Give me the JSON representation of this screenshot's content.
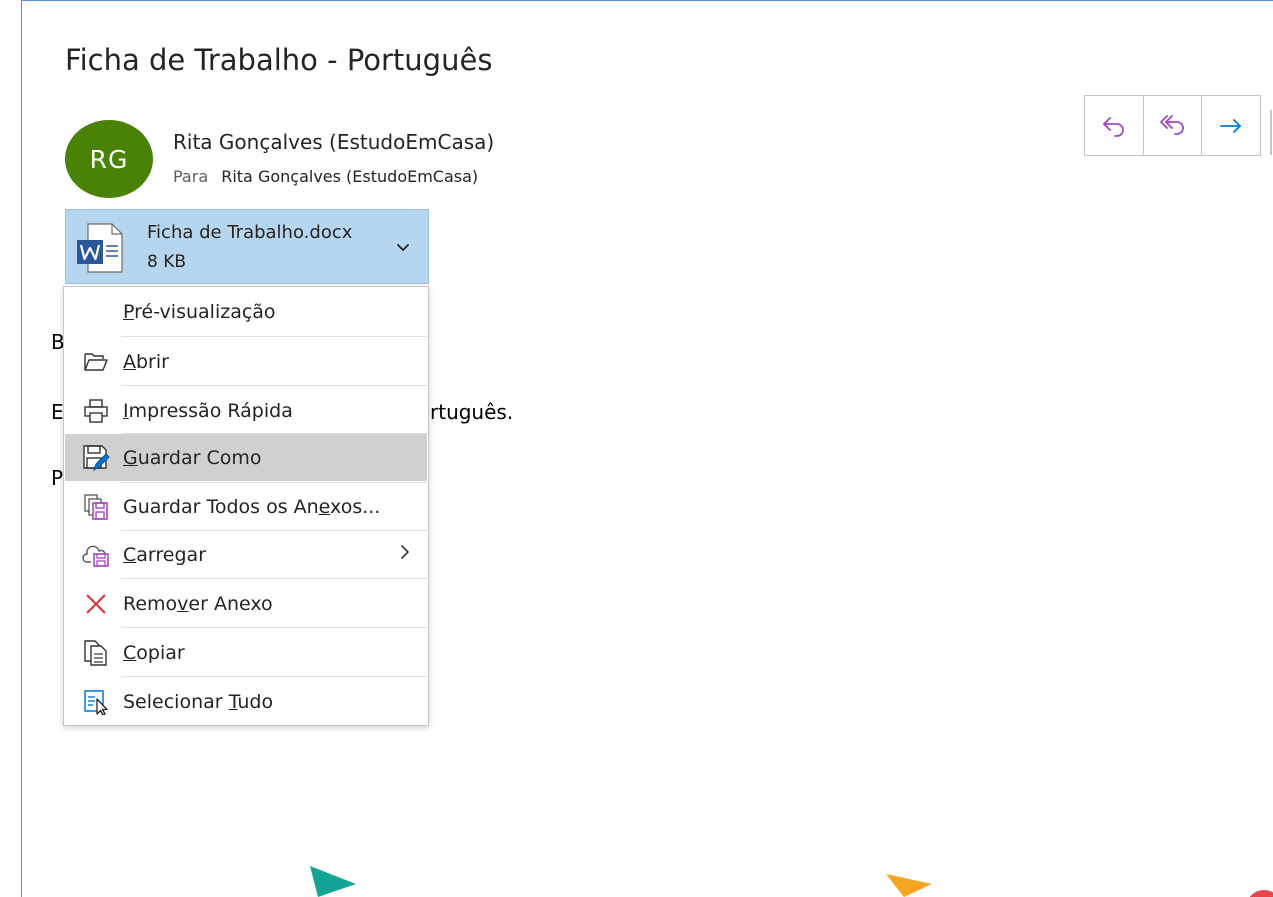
{
  "email": {
    "subject": "Ficha de Trabalho - Português",
    "avatar_initials": "RG",
    "avatar_color": "#498205",
    "sender": "Rita Gonçalves (EstudoEmCasa)",
    "to_label": "Para",
    "to_name": "Rita Gonçalves (EstudoEmCasa)"
  },
  "actions": [
    {
      "name": "reply",
      "icon": "reply-icon"
    },
    {
      "name": "reply-all",
      "icon": "reply-all-icon"
    },
    {
      "name": "forward",
      "icon": "forward-icon"
    }
  ],
  "attachment": {
    "icon": "word-document-icon",
    "name": "Ficha de Trabalho.docx",
    "size": "8 KB"
  },
  "body_lines": [
    {
      "text": "B"
    },
    {
      "text": "E",
      "suffix": "rtuguês."
    },
    {
      "text": "P"
    }
  ],
  "context_menu": {
    "items": [
      {
        "label": "Pré-visualização",
        "icon": null,
        "access_key": "P"
      },
      {
        "label": "Abrir",
        "icon": "folder-open-icon",
        "access_key": "A"
      },
      {
        "label": "Impressão Rápida",
        "icon": "printer-icon",
        "access_key": "I"
      },
      {
        "label": "Guardar Como",
        "icon": "save-as-icon",
        "access_key": "G",
        "highlighted": true
      },
      {
        "label": "Guardar Todos os Anexos...",
        "icon": "save-all-icon",
        "access_key": "e"
      },
      {
        "label": "Carregar",
        "icon": "cloud-upload-icon",
        "access_key": "C",
        "submenu": true
      },
      {
        "label": "Remover Anexo",
        "icon": "remove-icon",
        "access_key": "v"
      },
      {
        "label": "Copiar",
        "icon": "copy-icon",
        "access_key": "C"
      },
      {
        "label": "Selecionar Tudo",
        "icon": "select-all-icon",
        "access_key": "T"
      }
    ]
  },
  "colors": {
    "accent": "#0078d4",
    "attachment_bg": "#b6d5ef",
    "menu_highlight": "#d2d0ce",
    "remove_red": "#d13438",
    "reply_purple": "#a14bbf"
  }
}
